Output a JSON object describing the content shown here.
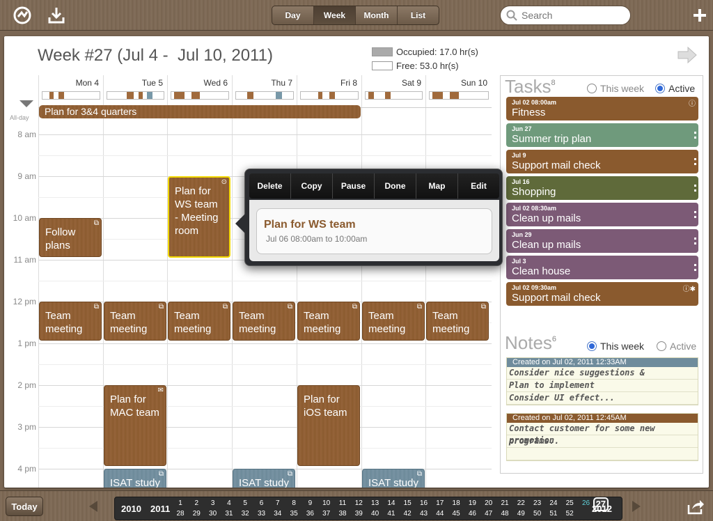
{
  "toolbar": {
    "views": [
      "Day",
      "Week",
      "Month",
      "List"
    ],
    "active_view": "Week",
    "search_placeholder": "Search",
    "icons": [
      "sync-icon",
      "download-icon",
      "add-icon"
    ]
  },
  "week": {
    "title": "Week #27 (Jul 4 -  Jul 10, 2011)",
    "occupied": "Occupied: 17.0 hr(s)",
    "free": "Free: 53.0 hr(s)",
    "occupied_color": "#aaaaaa",
    "free_color": "#ffffff"
  },
  "calendar": {
    "days": [
      "Mon 4",
      "Tue 5",
      "Wed 6",
      "Thu 7",
      "Fri 8",
      "Sat 9",
      "Sun 10"
    ],
    "times": [
      "8 am",
      "9 am",
      "10 am",
      "11 am",
      "12 pm",
      "1 pm",
      "2 pm",
      "3 pm",
      "4 pm"
    ],
    "allday_label": "All-day",
    "allday_event": "Plan for 3&4 quarters",
    "events": [
      {
        "title": "Follow plans",
        "day": 0,
        "color": "brown",
        "icon": "repeat-icon"
      },
      {
        "title": "Plan for WS team - Meeting room",
        "day": 2,
        "color": "brown",
        "icon": "alarm-icon",
        "selected": true
      },
      {
        "title": "Team meeting",
        "day": 0,
        "color": "brown",
        "icon": "repeat-icon"
      },
      {
        "title": "Team meeting",
        "day": 1,
        "color": "brown",
        "icon": "repeat-icon"
      },
      {
        "title": "Team meeting",
        "day": 2,
        "color": "brown",
        "icon": "repeat-icon"
      },
      {
        "title": "Team meeting",
        "day": 3,
        "color": "brown",
        "icon": "repeat-icon"
      },
      {
        "title": "Team meeting",
        "day": 4,
        "color": "brown",
        "icon": "repeat-icon"
      },
      {
        "title": "Team meeting",
        "day": 5,
        "color": "brown",
        "icon": "repeat-icon"
      },
      {
        "title": "Team meeting",
        "day": 6,
        "color": "brown",
        "icon": "repeat-icon"
      },
      {
        "title": "Plan for MAC team",
        "day": 1,
        "color": "brown",
        "icon": "mail-icon"
      },
      {
        "title": "Plan for iOS team",
        "day": 4,
        "color": "brown",
        "icon": ""
      },
      {
        "title": "ISAT study cl...",
        "day": 1,
        "color": "blue",
        "icon": "repeat-icon"
      },
      {
        "title": "ISAT study cl...",
        "day": 3,
        "color": "blue",
        "icon": "repeat-icon"
      },
      {
        "title": "ISAT study cl...",
        "day": 5,
        "color": "blue",
        "icon": "repeat-icon"
      }
    ],
    "event_colors": {
      "brown": "#8c5c30",
      "blue": "#6f8c9c",
      "selected_border": "#f2d800"
    }
  },
  "popover": {
    "actions": [
      "Delete",
      "Copy",
      "Pause",
      "Done",
      "Map",
      "Edit"
    ],
    "title": "Plan for WS team",
    "time": "Jul 06 08:00am to 10:00am"
  },
  "tasks": {
    "title": "Tasks",
    "count": "8",
    "filter_week": "This week",
    "filter_active": "Active",
    "selected_filter": "Active",
    "items": [
      {
        "date": "Jul 02 08:00am",
        "name": "Fitness",
        "color": "#8a5a2e",
        "indicator": "ⓘ"
      },
      {
        "date": "Jun 27",
        "name": "Summer trip plan",
        "color": "#6f9a7c",
        "indicator": ""
      },
      {
        "date": "Jul 9",
        "name": "Support mail check",
        "color": "#8a5a2e",
        "indicator": ""
      },
      {
        "date": "Jul 16",
        "name": "Shopping",
        "color": "#5f6a3a",
        "indicator": ""
      },
      {
        "date": "Jul 02 08:30am",
        "name": "Clean up mails",
        "color": "#7c5a76",
        "indicator": ""
      },
      {
        "date": "Jun 29",
        "name": "Clean up mails",
        "color": "#7c5a76",
        "indicator": ""
      },
      {
        "date": "Jul 3",
        "name": "Clean house",
        "color": "#7c5a76",
        "indicator": ""
      },
      {
        "date": "Jul 02 09:30am",
        "name": "Support mail check",
        "color": "#8a5a2e",
        "indicator": "ⓘ✱"
      }
    ]
  },
  "notes": {
    "title": "Notes",
    "count": "6",
    "filter_week": "This week",
    "filter_active": "Active",
    "selected_filter": "This week",
    "items": [
      {
        "created": "Created on  Jul 02, 2011 12:33AM",
        "color": "#6f8c9c",
        "lines": [
          "Consider nice suggestions &",
          "Plan to implement",
          "Consider UI effect..."
        ]
      },
      {
        "created": "Created on  Jul 02, 2011 12:45AM",
        "color": "#8a5a2e",
        "lines": [
          "Contact customer for some new promotion",
          "programs..",
          ""
        ]
      }
    ]
  },
  "bottom": {
    "today_label": "Today",
    "year_prev2": "2010",
    "year_prev": "2011",
    "year_next": "2012",
    "weeks_top": [
      "1",
      "2",
      "3",
      "4",
      "5",
      "6",
      "7",
      "8",
      "9",
      "10",
      "11",
      "12",
      "13",
      "14",
      "15",
      "16",
      "17",
      "18",
      "19",
      "20",
      "21",
      "22",
      "23",
      "24",
      "25",
      "26"
    ],
    "weeks_bottom": [
      "28",
      "29",
      "30",
      "31",
      "32",
      "33",
      "34",
      "35",
      "36",
      "37",
      "38",
      "39",
      "40",
      "41",
      "42",
      "43",
      "44",
      "45",
      "46",
      "47",
      "48",
      "49",
      "50",
      "51",
      "52"
    ],
    "current_week": "27",
    "highlight_week": "26"
  }
}
